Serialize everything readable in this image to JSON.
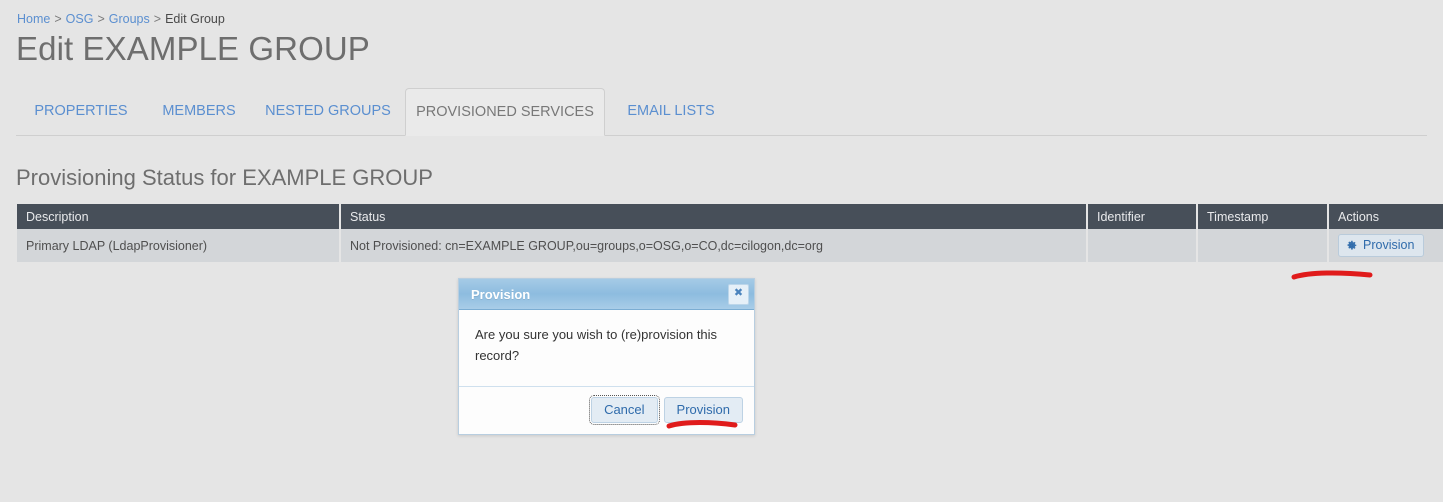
{
  "breadcrumb": {
    "items": [
      {
        "label": "Home",
        "link": true
      },
      {
        "label": "OSG",
        "link": true
      },
      {
        "label": "Groups",
        "link": true
      },
      {
        "label": "Edit Group",
        "link": false
      }
    ],
    "separator": ">"
  },
  "page": {
    "title": "Edit EXAMPLE GROUP",
    "section_heading": "Provisioning Status for EXAMPLE GROUP",
    "background_color": "#e5e5e5"
  },
  "tabs": [
    {
      "label": "PROPERTIES",
      "active": false
    },
    {
      "label": "MEMBERS",
      "active": false
    },
    {
      "label": "NESTED GROUPS",
      "active": false
    },
    {
      "label": "PROVISIONED SERVICES",
      "active": true
    },
    {
      "label": "EMAIL LISTS",
      "active": false
    }
  ],
  "table": {
    "headers": [
      "Description",
      "Status",
      "Identifier",
      "Timestamp",
      "Actions"
    ],
    "header_bg": "#474f59",
    "row_bg": "#d3d6d9",
    "rows": [
      {
        "description": "Primary LDAP (LdapProvisioner)",
        "status": "Not Provisioned: cn=EXAMPLE GROUP,ou=groups,o=OSG,o=CO,dc=cilogon,dc=org",
        "identifier": "",
        "timestamp": "",
        "action_label": "Provision",
        "action_icon": "gear-icon"
      }
    ]
  },
  "dialog": {
    "title": "Provision",
    "close_icon": "✖",
    "message": "Are you sure you wish to (re)provision this record?",
    "cancel_label": "Cancel",
    "confirm_label": "Provision",
    "titlebar_color": "#8dbcdf",
    "accent_color": "#2f6bab"
  },
  "annotations": {
    "color": "#e01b1b",
    "marks": [
      {
        "name": "underline-row-provision"
      },
      {
        "name": "underline-dialog-provision"
      }
    ]
  }
}
